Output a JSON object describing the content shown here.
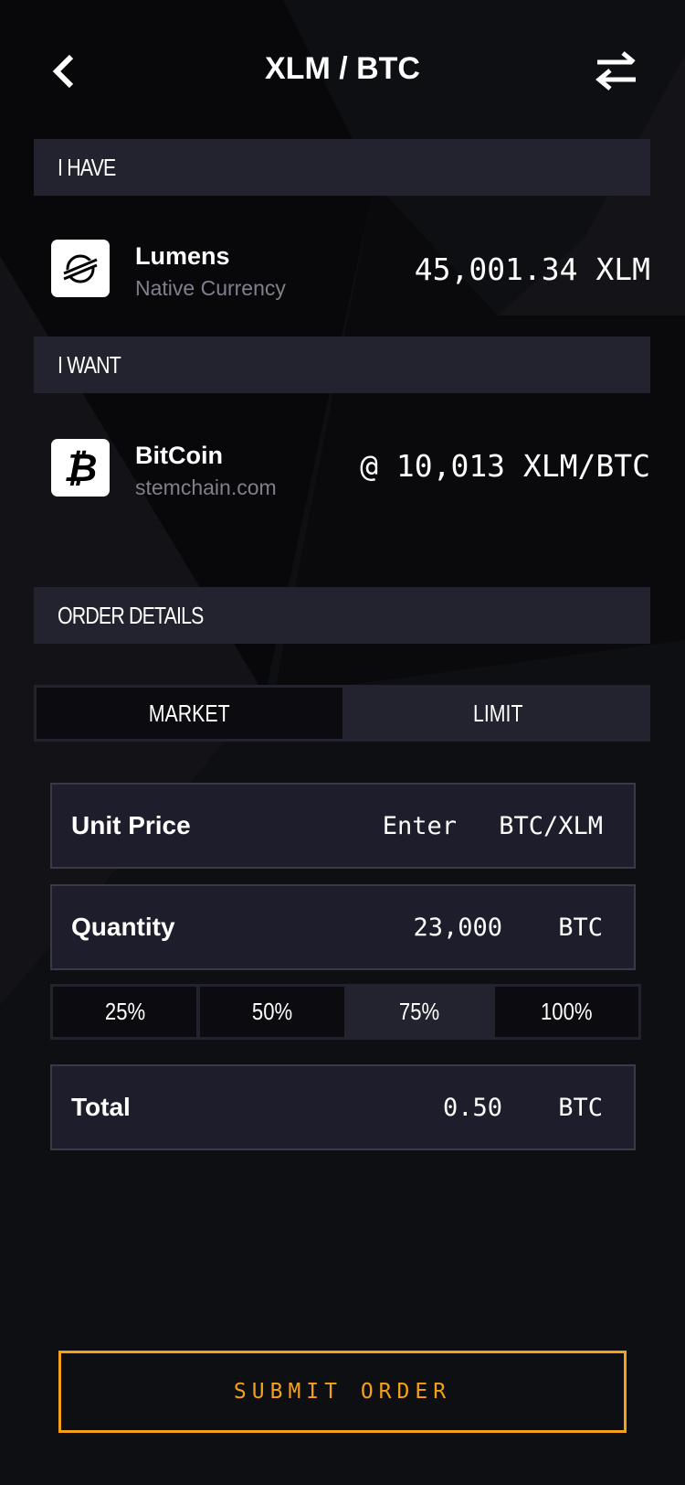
{
  "header": {
    "title": "XLM / BTC",
    "back_icon": "chevron-left-icon",
    "swap_icon": "swap-arrows-icon"
  },
  "have": {
    "section_label": "I HAVE",
    "name": "Lumens",
    "subtitle": "Native Currency",
    "amount": "45,001.34 XLM",
    "icon": "stellar-icon"
  },
  "want": {
    "section_label": "I WANT",
    "name": "BitCoin",
    "subtitle": "stemchain.com",
    "rate": "@ 10,013 XLM/BTC",
    "icon": "bitcoin-icon"
  },
  "order": {
    "section_label": "ORDER DETAILS",
    "tabs": [
      {
        "label": "MARKET",
        "selected": false
      },
      {
        "label": "LIMIT",
        "selected": true
      }
    ],
    "unit_price": {
      "label": "Unit Price",
      "placeholder": "Enter",
      "unit": "BTC/XLM"
    },
    "quantity": {
      "label": "Quantity",
      "value": "23,000",
      "unit": "BTC"
    },
    "percentages": [
      {
        "label": "25%"
      },
      {
        "label": "50%"
      },
      {
        "label": "75%",
        "selected": true
      },
      {
        "label": "100%"
      }
    ],
    "total": {
      "label": "Total",
      "value": "0.50",
      "unit": "BTC"
    }
  },
  "submit_label": "SUBMIT ORDER",
  "colors": {
    "accent": "#f5a01a",
    "background": "#0e0f13",
    "section_bar": "#23232f",
    "field": "#1e1d2b"
  }
}
